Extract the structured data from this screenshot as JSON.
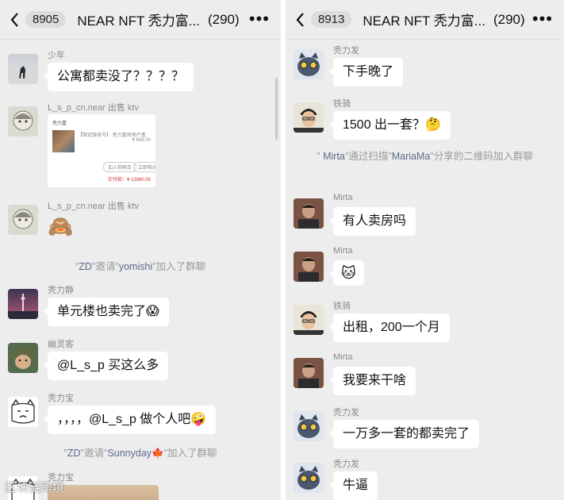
{
  "left": {
    "header": {
      "back_count": "8905",
      "title": "NEAR NFT 秃力富...",
      "member_count": "(290)",
      "more": "•••"
    },
    "messages": [
      {
        "sender": "少年",
        "text": "公寓都卖没了？？？？"
      },
      {
        "sender": "L_s_p_cn.near 出售 ktv"
      },
      {
        "sender": "L_s_p_cn.near 出售 ktv",
        "emoji": "🙈"
      },
      {
        "sender": "秃力静",
        "text": "单元楼也卖完了😱"
      },
      {
        "sender": "幽灵客",
        "text": "@L_s_p 买这么多"
      },
      {
        "sender": "秃力宝",
        "text": "，，，，@L_s_p 做个人吧🤪"
      },
      {
        "sender": "秃力宝"
      }
    ],
    "card": {
      "shop": "秃力富",
      "line1": "【限定版收号】 秃力富房地产盒",
      "line2": "¥ 698.00",
      "btn1": "加入购物车",
      "btn2": "立即购买",
      "total": "实付款：¥ 13980.00"
    },
    "system1": {
      "q1": "\"",
      "a": "ZD",
      "mid": "\"邀请\"",
      "b": "yomishi",
      "end": "\"加入了群聊"
    },
    "system2": {
      "q1": "\"",
      "a": "ZD",
      "mid": "\"邀请\"",
      "b": "Sunnyday🍁",
      "end": "\"加入了群聊"
    },
    "watermark": "区块链跨境"
  },
  "right": {
    "header": {
      "back_count": "8913",
      "title": "NEAR NFT 秃力富...",
      "member_count": "(290)",
      "more": "•••"
    },
    "messages": [
      {
        "sender": "秃力发",
        "text": "下手晚了"
      },
      {
        "sender": "铁骑",
        "text": "1500 出一套？🤔"
      },
      {
        "sender": "Mirta",
        "text": "有人卖房吗"
      },
      {
        "sender": "Mirta",
        "emoji": "🐱"
      },
      {
        "sender": "铁骑",
        "text": "出租，200一个月"
      },
      {
        "sender": "Mirta",
        "text": "我要来干啥"
      },
      {
        "sender": "秃力发",
        "text": "一万多一套的都卖完了"
      },
      {
        "sender": "秃力发",
        "text": "牛逼"
      }
    ],
    "system": {
      "q1": "\" ",
      "a": "Mirta",
      "mid": "\"通过扫描\"",
      "b": "MariaMa",
      "end": "\"分享的二维码加入群聊"
    }
  },
  "colors": {
    "background": "#ededed",
    "bubble": "#ffffff",
    "system_text": "#9a9a9a",
    "system_name": "#5b6a8c"
  }
}
